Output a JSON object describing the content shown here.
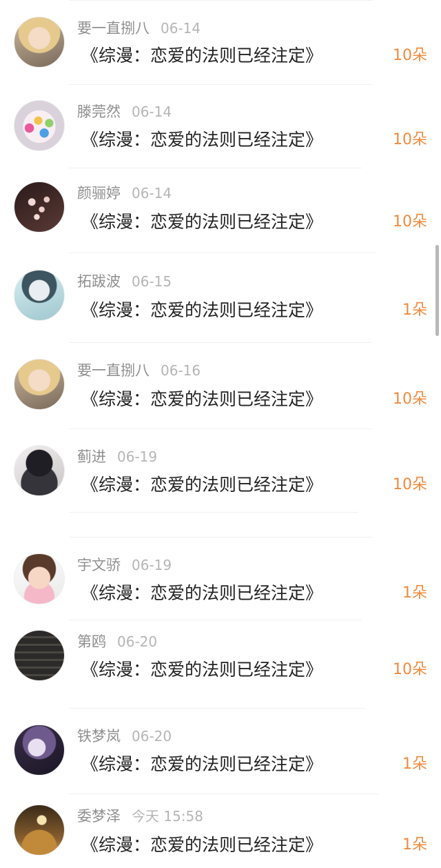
{
  "records": [
    {
      "user": "要一直捌八",
      "date": "06-14",
      "book": "《综漫：恋爱的法则已经注定》",
      "amount": "10朵",
      "avatar": "blonde-girl-avatar"
    },
    {
      "user": "滕莞然",
      "date": "06-14",
      "book": "《综漫：恋爱的法则已经注定》",
      "amount": "10朵",
      "avatar": "candy-jar-avatar"
    },
    {
      "user": "颜骊婷",
      "date": "06-14",
      "book": "《综漫：恋爱的法则已经注定》",
      "amount": "10朵",
      "avatar": "blossom-avatar"
    },
    {
      "user": "拓跋波",
      "date": "06-15",
      "book": "《综漫：恋爱的法则已经注定》",
      "amount": "1朵",
      "avatar": "boy-avatar"
    },
    {
      "user": "要一直捌八",
      "date": "06-16",
      "book": "《综漫：恋爱的法则已经注定》",
      "amount": "10朵",
      "avatar": "blonde-girl-avatar"
    },
    {
      "user": "蓟进",
      "date": "06-19",
      "book": "《综漫：恋爱的法则已经注定》",
      "amount": "10朵",
      "avatar": "selfie-avatar"
    },
    {
      "user": "宇文骄",
      "date": "06-19",
      "book": "《综漫：恋爱的法则已经注定》",
      "amount": "1朵",
      "avatar": "baby-girl-avatar"
    },
    {
      "user": "第鸥",
      "date": "06-20",
      "book": "《综漫：恋爱的法则已经注定》",
      "amount": "10朵",
      "avatar": "stairs-avatar"
    },
    {
      "user": "铁梦岚",
      "date": "06-20",
      "book": "《综漫：恋爱的法则已经注定》",
      "amount": "1朵",
      "avatar": "anime-character-avatar"
    },
    {
      "user": "委梦泽",
      "date": "今天 15:58",
      "book": "《综漫：恋爱的法则已经注定》",
      "amount": "1朵",
      "avatar": "moon-scene-avatar"
    }
  ]
}
